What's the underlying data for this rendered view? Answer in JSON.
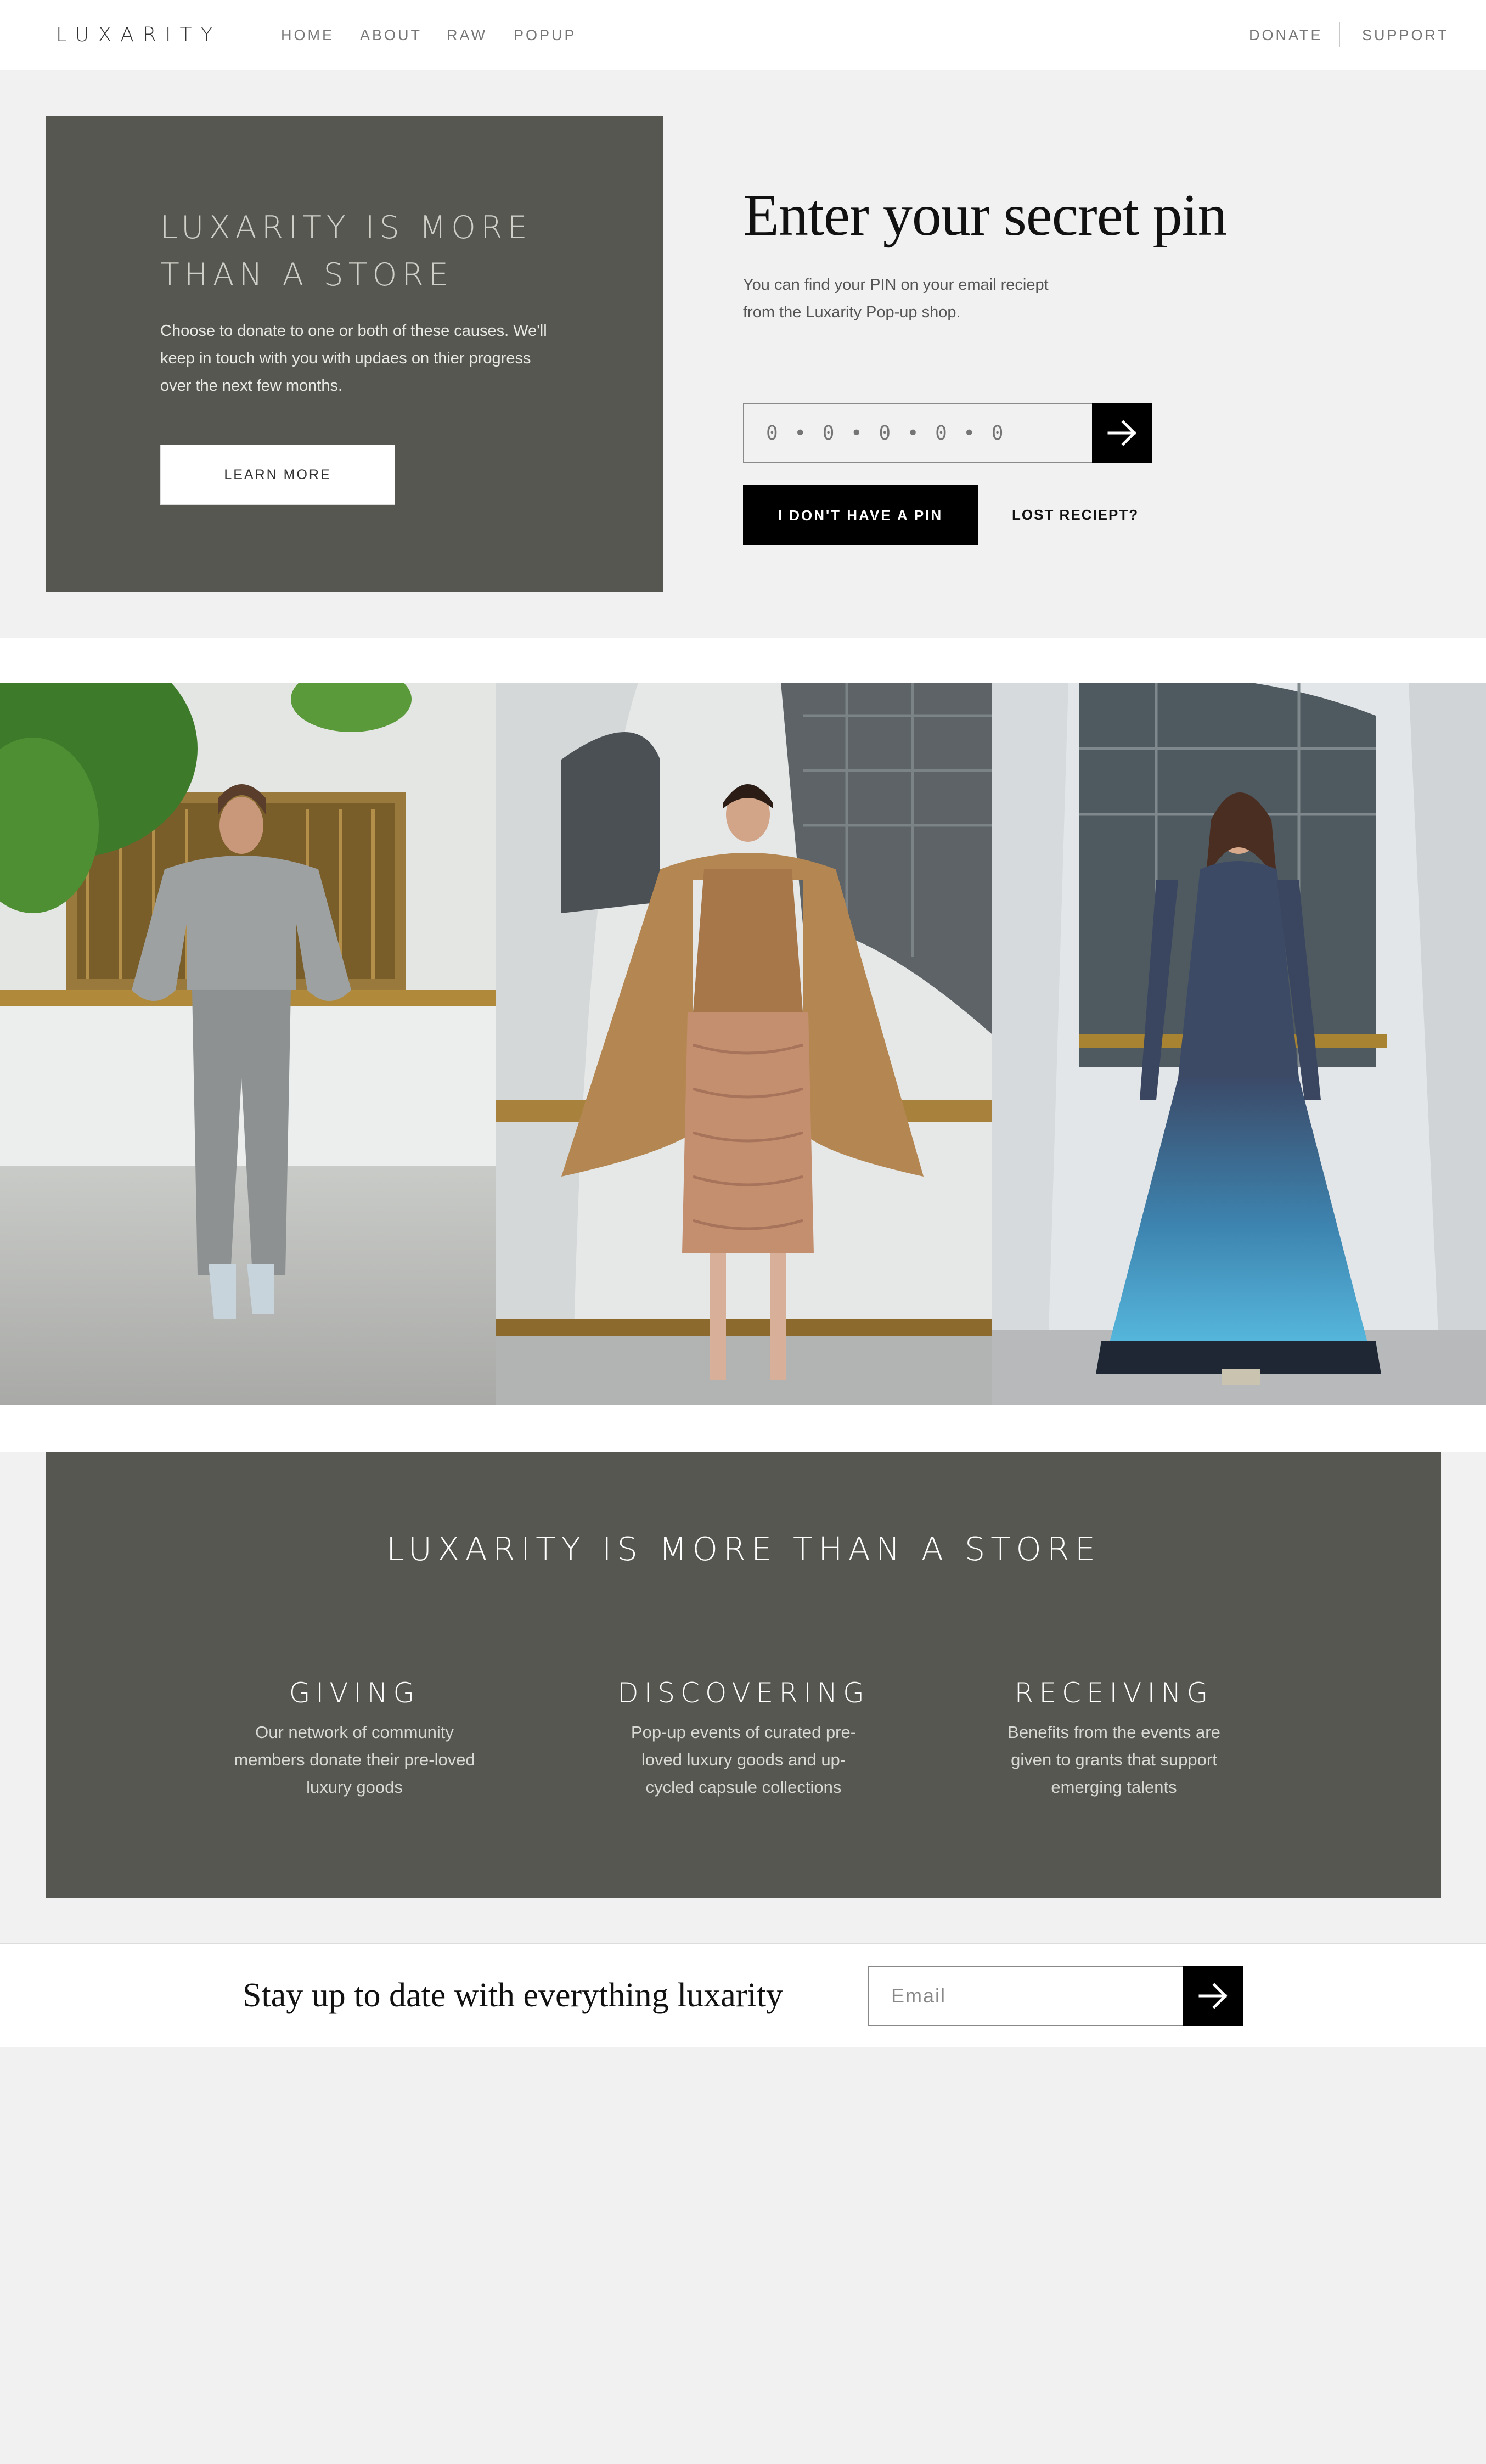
{
  "nav": {
    "logo": "LUXARITY",
    "links": [
      "HOME",
      "ABOUT",
      "RAW",
      "POPUP"
    ],
    "right_links": [
      "DONATE",
      "SUPPORT"
    ]
  },
  "hero": {
    "card_title": "LUXARITY IS MORE THAN A STORE",
    "card_text": "Choose to donate to one or both of these causes. We'll keep in touch with you with updaes on thier progress over the next few months.",
    "learn_more_label": "LEARN MORE",
    "pin_title": "Enter your secret pin",
    "pin_subtitle": "You can find your PIN on your email reciept from the Luxarity Pop-up shop.",
    "pin_placeholder": "0 • 0 • 0 • 0 • 0",
    "submit_icon": "arrow-right-icon",
    "no_pin_label": "I DON'T HAVE A PIN",
    "lost_receipt_label": "LOST RECIEPT?"
  },
  "gallery": {
    "photos": [
      "model-grey-outfit",
      "model-tan-coat",
      "model-blue-gown"
    ]
  },
  "info": {
    "title": "LUXARITY IS MORE THAN A STORE",
    "columns": [
      {
        "heading": "GIVING",
        "text": "Our network of community members donate their pre-loved luxury goods"
      },
      {
        "heading": "DISCOVERING",
        "text": "Pop-up events of curated pre-loved luxury goods and up-cycled capsule collections"
      },
      {
        "heading": "RECEIVING",
        "text": "Benefits from the events are given to grants that support emerging talents"
      }
    ]
  },
  "newsletter": {
    "title": "Stay up to date with everything luxarity",
    "email_placeholder": "Email",
    "submit_icon": "arrow-right-icon"
  },
  "colors": {
    "card_bg": "#575752",
    "page_bg": "#f1f1f1",
    "button_black": "#000000"
  }
}
